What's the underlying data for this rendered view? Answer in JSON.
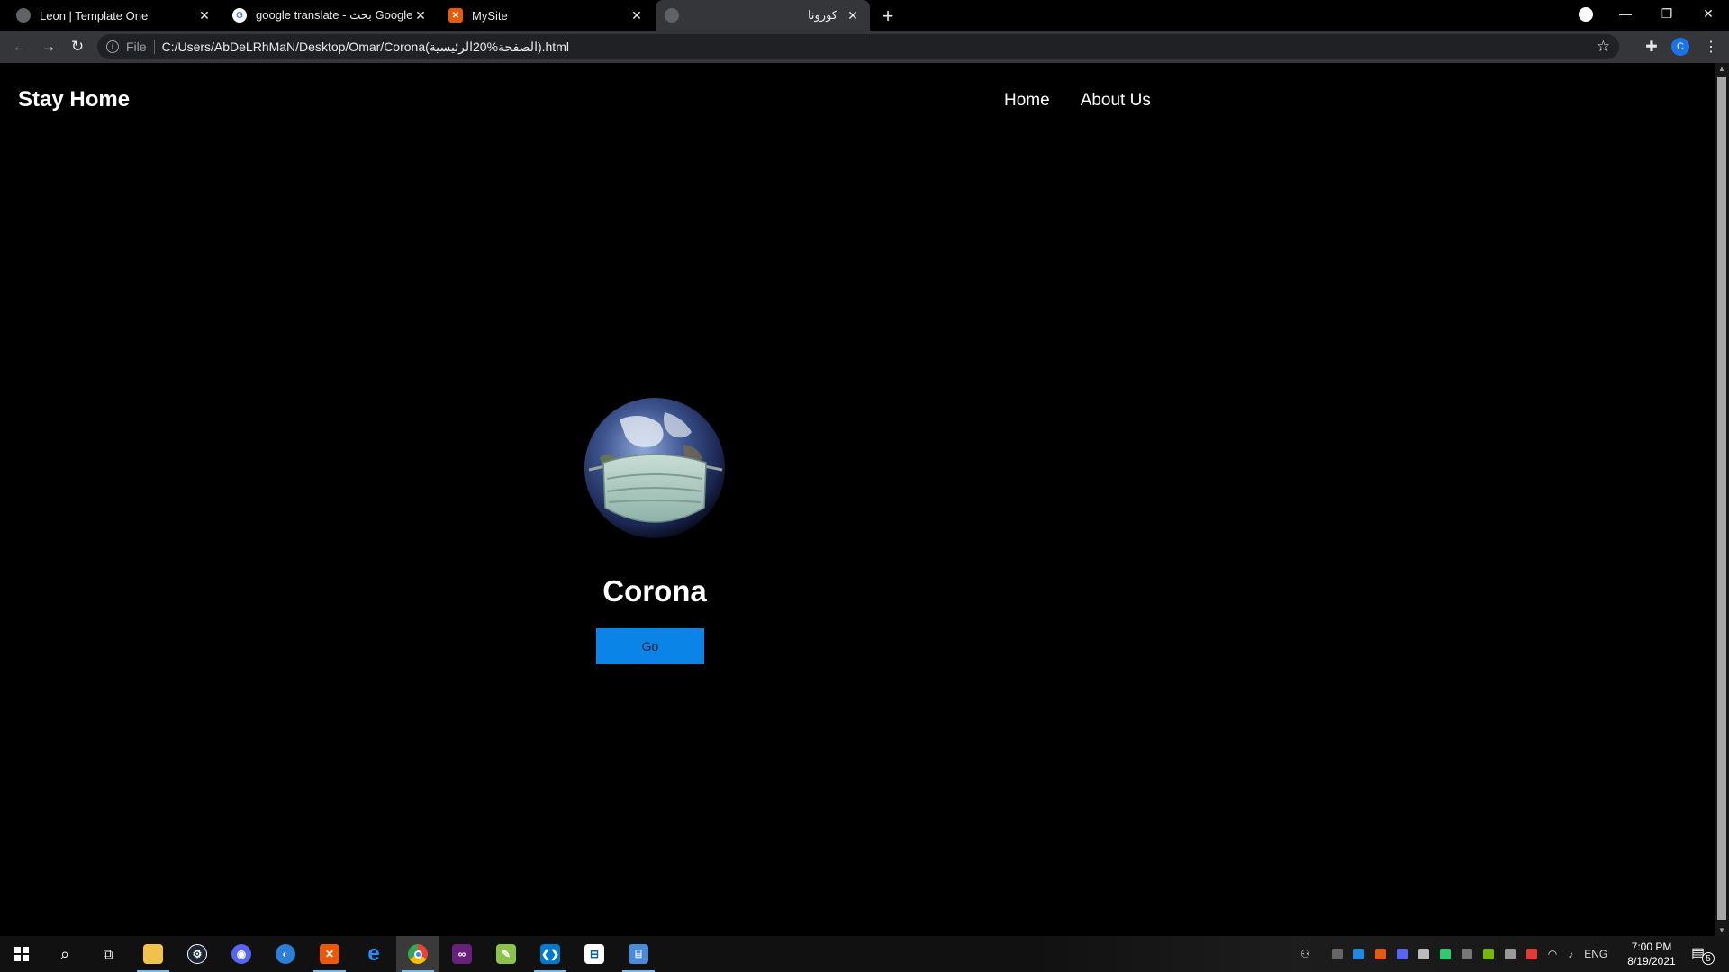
{
  "browser": {
    "tabs": [
      {
        "title": "Leon | Template One",
        "favicon": "globe-icon"
      },
      {
        "title": "google translate - بحث Google",
        "favicon": "google-icon"
      },
      {
        "title": "MySite",
        "favicon": "xampp-icon"
      },
      {
        "title": "كورونا",
        "favicon": "globe-icon",
        "active": true
      }
    ],
    "new_tab_glyph": "+",
    "address": {
      "scheme_label": "File",
      "url": "C:/Users/AbDeLRhMaN/Desktop/Omar/Corona(الصفحة%20الرئيسية).html"
    },
    "profile_initial": "C"
  },
  "page": {
    "logo": "Stay Home",
    "nav": [
      {
        "label": "Home"
      },
      {
        "label": "About Us"
      }
    ],
    "hero": {
      "image": "earth-with-face-mask",
      "title": "Corona",
      "button_label": "Go"
    },
    "colors": {
      "background": "#000000",
      "text": "#ffffff",
      "button": "#0a84e6"
    }
  },
  "taskbar": {
    "apps": [
      {
        "name": "file-explorer-icon",
        "open": true
      },
      {
        "name": "steam-icon",
        "open": false
      },
      {
        "name": "discord-icon",
        "open": false
      },
      {
        "name": "app-blue-circle-icon",
        "open": false
      },
      {
        "name": "xampp-icon",
        "open": true
      },
      {
        "name": "edge-icon",
        "open": false
      },
      {
        "name": "chrome-icon",
        "open": true,
        "active": true
      },
      {
        "name": "visual-studio-icon",
        "open": false
      },
      {
        "name": "notepadpp-icon",
        "open": false
      },
      {
        "name": "vscode-icon",
        "open": true
      },
      {
        "name": "tool-icon",
        "open": false
      },
      {
        "name": "network-app-icon",
        "open": true
      }
    ],
    "language": "ENG",
    "time": "7:00 PM",
    "date": "8/19/2021",
    "notifications": "5"
  }
}
